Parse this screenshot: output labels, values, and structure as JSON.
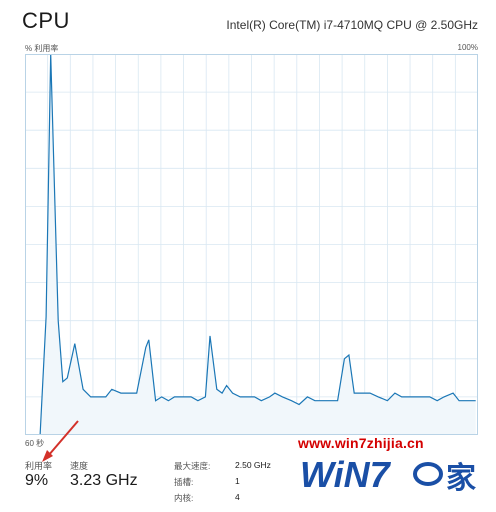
{
  "header": {
    "title": "CPU",
    "cpu_name": "Intel(R) Core(TM) i7-4710MQ CPU @ 2.50GHz"
  },
  "axes": {
    "top_left": "% 利用率",
    "top_right": "100%",
    "bottom_left": "60 秒"
  },
  "chart_data": {
    "type": "area",
    "xlabel": "",
    "ylabel": "",
    "xlim": [
      60,
      0
    ],
    "ylim": [
      0,
      100
    ],
    "x": [
      60,
      58,
      57.2,
      56.6,
      55.6,
      55,
      54.4,
      53.4,
      52.3,
      51.3,
      50.5,
      49.3,
      48.5,
      47.3,
      46.4,
      45.2,
      44,
      43.6,
      42.7,
      41.9,
      41,
      40.2,
      39.1,
      38,
      37.1,
      36.1,
      35.5,
      34.6,
      33.9,
      33.3,
      32.5,
      31.5,
      30.6,
      29.6,
      28.7,
      27.6,
      26.9,
      25.9,
      24.7,
      23.7,
      22.6,
      21.6,
      20.4,
      19.4,
      18.6,
      17.7,
      17.1,
      16.4,
      15.3,
      14.3,
      13.2,
      12,
      11,
      10.1,
      9.3,
      8.2,
      7.4,
      6.4,
      5.4,
      4.5,
      3.3,
      2.5,
      1.4,
      0.3
    ],
    "values": [
      0,
      0,
      31,
      100,
      30,
      14,
      15,
      24,
      12,
      10,
      10,
      10,
      12,
      11,
      11,
      11,
      23,
      25,
      9,
      10,
      9,
      10,
      10,
      10,
      9,
      10,
      26,
      12,
      11,
      13,
      11,
      10,
      10,
      10,
      9,
      10,
      11,
      10,
      9,
      8,
      10,
      9,
      9,
      9,
      9,
      20,
      21,
      11,
      11,
      11,
      10,
      9,
      11,
      10,
      10,
      10,
      10,
      10,
      9,
      10,
      11,
      9,
      9,
      9
    ],
    "grid": true,
    "line_color": "#1b77b6",
    "fill_color": "#f1f7fb",
    "grid_color": "#d8e7f2"
  },
  "stats": {
    "utilization_label": "利用率",
    "utilization_value": "9%",
    "speed_label": "速度",
    "speed_value": "3.23 GHz",
    "max_speed_label": "最大速度:",
    "max_speed_value": "2.50 GHz",
    "sockets_label": "插槽:",
    "sockets_value": "1",
    "cores_label": "内核:",
    "cores_value": "4"
  },
  "watermark": {
    "url": "www.win7zhijia.cn",
    "logo_text": "WiN7",
    "logo_suffix": "家",
    "logo_color": "#1a4fa6",
    "url_color": "#d40000"
  },
  "annotation": {
    "arrow_color": "#d3312a"
  }
}
